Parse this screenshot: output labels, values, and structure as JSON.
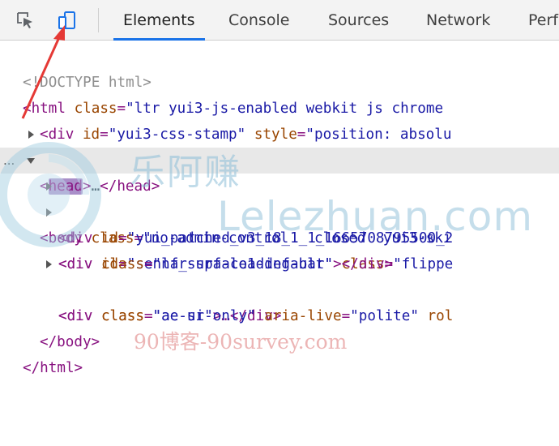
{
  "toolbar": {
    "inspect_icon": "inspect-cursor-icon",
    "device_icon": "device-toggle-icon",
    "tabs": [
      {
        "label": "Elements",
        "active": true
      },
      {
        "label": "Console",
        "active": false
      },
      {
        "label": "Sources",
        "active": false
      },
      {
        "label": "Network",
        "active": false
      },
      {
        "label": "Perf",
        "active": false
      }
    ]
  },
  "dom_tree": {
    "doctype": "<!DOCTYPE html>",
    "html_open": {
      "tag": "<html",
      "attr": "class",
      "value": "\"ltr yui3-js-enabled webkit js chrome"
    },
    "div_stamp": {
      "tag": "<div",
      "attr1": "id",
      "value1": "\"yui3-css-stamp\"",
      "attr2": "style",
      "value2": "\"position: absolu"
    },
    "head": {
      "open": "<",
      "name": "head",
      "close": ">",
      "ellipsis": "…",
      "end": "</head>"
    },
    "body_open": {
      "tag": "<body",
      "attr": "class",
      "value": "\"no-admin-control   closed  yui3-ski"
    },
    "div_patched": {
      "tag": "<div",
      "attr": "id",
      "value": "\"yui_patched_v3_18_1_1_1665708795500_2"
    },
    "div_senna": {
      "tag": "<div",
      "attr1": "id",
      "value1": "\"senna_surface1-default\"",
      "attr2": "class",
      "value2": "\"flippe"
    },
    "div_loading": {
      "tag": "<div",
      "attr": "class",
      "value": "\"lfr-spa-loading-bar\"",
      "end": "></div>"
    },
    "div_aeui": {
      "tag": "<div",
      "attr": "class",
      "value": "\"ae-ui\"",
      "ellipsis": ">…</div>"
    },
    "div_aesr": {
      "tag": "<div",
      "attr1": "class",
      "value1": "\"ae-sr-only\"",
      "attr2": "aria-live",
      "value2": "\"polite\"",
      "trail": "rol"
    },
    "body_close": "</body>",
    "html_close": "</html>",
    "selected_marker": "..."
  },
  "watermark": {
    "cn": "乐阿赚",
    "en": "Lelezhuan.com",
    "bottom": "90博客-90survey.com"
  },
  "colors": {
    "tag": "#881280",
    "attr": "#994500",
    "value": "#1a1aa6",
    "active_tab_underline": "#1a73e8",
    "annotation_arrow": "#e53935"
  }
}
